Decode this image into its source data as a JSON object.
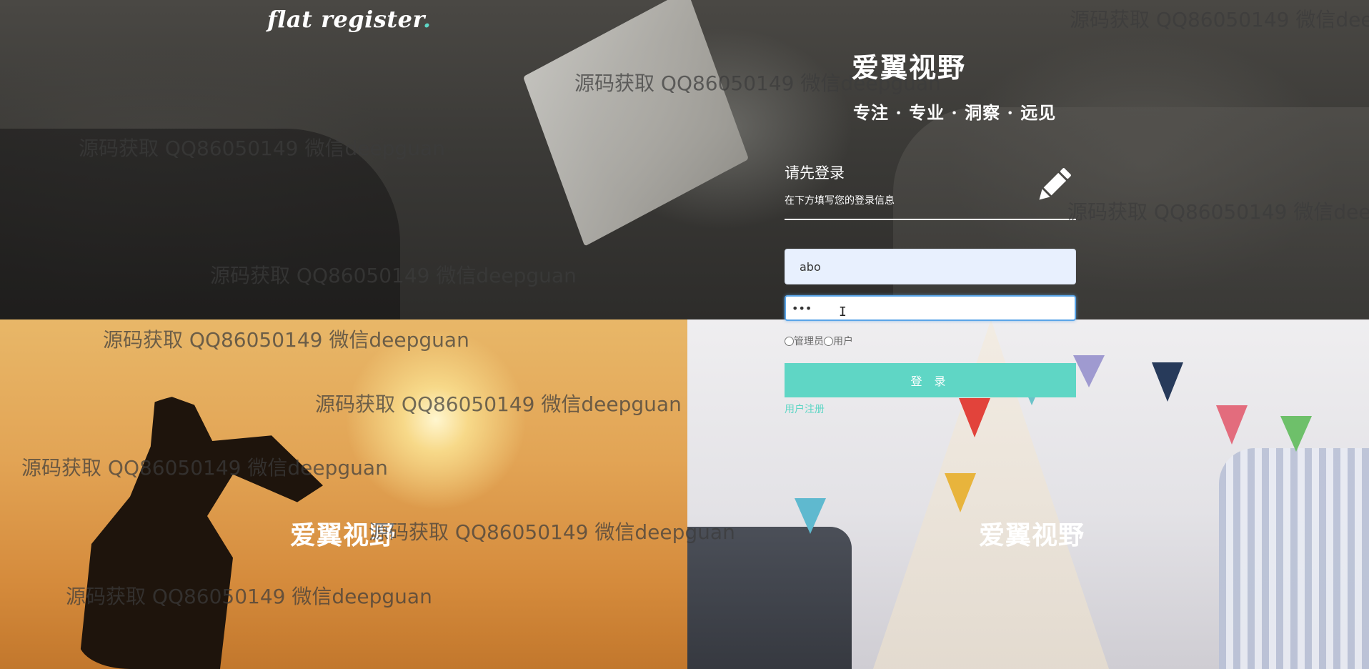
{
  "brand": {
    "name": "flat register",
    "dot": "."
  },
  "login": {
    "logo_title": "爱翼视野",
    "logo_slogan": "专注 · 专业 · 洞察 · 远见",
    "title": "请先登录",
    "subtitle": "在下方填写您的登录信息",
    "username_value": "abo",
    "password_value": "•••",
    "roles": [
      "管理员",
      "用户"
    ],
    "submit_label": "登 录",
    "register_link": "用户注册"
  },
  "panels": {
    "left_brand": "爱翼视野",
    "right_brand": "爱翼视野"
  },
  "watermark": {
    "text": "源码获取 QQ86050149 微信deepguan"
  },
  "colors": {
    "accent": "#5fd6c5",
    "input_focus": "#5aa5e8"
  },
  "icons": {
    "edit": "pencil-icon",
    "cursor": "text-cursor-icon"
  }
}
